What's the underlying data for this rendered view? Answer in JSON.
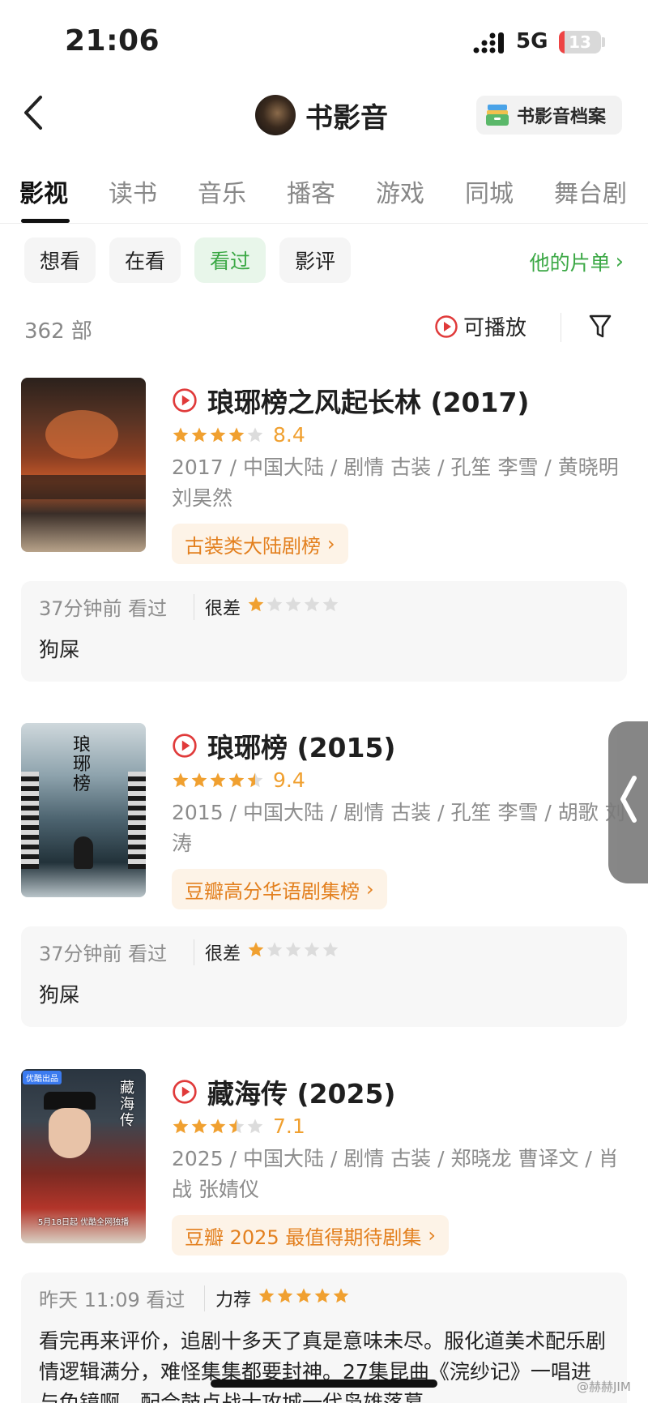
{
  "status_bar": {
    "time": "21:06",
    "network": "5G",
    "battery": "13",
    "battery_level_percent": 13,
    "battery_color": "#ee4444"
  },
  "nav": {
    "title": "书影音",
    "archive_label": "书影音档案",
    "icons": [
      "back-chevron-icon",
      "avatar",
      "archive-icon"
    ]
  },
  "tabs": [
    {
      "label": "影视",
      "active": true
    },
    {
      "label": "读书",
      "active": false
    },
    {
      "label": "音乐",
      "active": false
    },
    {
      "label": "播客",
      "active": false
    },
    {
      "label": "游戏",
      "active": false
    },
    {
      "label": "同城",
      "active": false
    },
    {
      "label": "舞台剧",
      "active": false
    }
  ],
  "filters": {
    "chips": [
      {
        "label": "想看",
        "active": false
      },
      {
        "label": "在看",
        "active": false
      },
      {
        "label": "看过",
        "active": true
      },
      {
        "label": "影评",
        "active": false
      }
    ],
    "her_list": "他的片单",
    "count": "362 部",
    "playable": "可播放"
  },
  "colors": {
    "accent_green": "#3ba845",
    "star_orange": "#f0a030",
    "rank_orange": "#e3801f",
    "play_red": "#e03a3a"
  },
  "items": [
    {
      "title": "琅琊榜之风起长林 (2017)",
      "stars": 4,
      "rating": "8.4",
      "meta": "2017 / 中国大陆 / 剧情 古装 / 孔笙 李雪 / 黄晓明 刘昊然",
      "rank": "古装类大陆剧榜",
      "review": {
        "time": "37分钟前 看过",
        "verdict": "很差",
        "stars": 1,
        "text": "狗屎"
      }
    },
    {
      "title": "琅琊榜 (2015)",
      "stars": 4.5,
      "rating": "9.4",
      "meta": "2015 / 中国大陆 / 剧情 古装 / 孔笙 李雪 / 胡歌 刘涛",
      "rank": "豆瓣高分华语剧集榜",
      "poster_text": "琅琊榜",
      "review": {
        "time": "37分钟前 看过",
        "verdict": "很差",
        "stars": 1,
        "text": "狗屎"
      }
    },
    {
      "title": "藏海传 (2025)",
      "stars": 3.5,
      "rating": "7.1",
      "meta": "2025 / 中国大陆 / 剧情 古装 / 郑晓龙 曹译文 / 肖战 张婧仪",
      "rank": "豆瓣 2025 最值得期待剧集",
      "poster_text": "藏海传",
      "poster_badge": "优酷出品",
      "poster_caption": "5月18日起 优酷全网独播",
      "review": {
        "time": "昨天 11:09 看过",
        "verdict": "力荐",
        "stars": 5,
        "text": "看完再来评价，追剧十多天了真是意味未尽。服化道美术配乐剧情逻辑满分，难怪集集都要封神。27集昆曲《浣纱记》一唱进与兔镜啊，配合鼓点战士攻城一代枭雄落幕"
      }
    }
  ],
  "watermark": "@赫赫JIM"
}
